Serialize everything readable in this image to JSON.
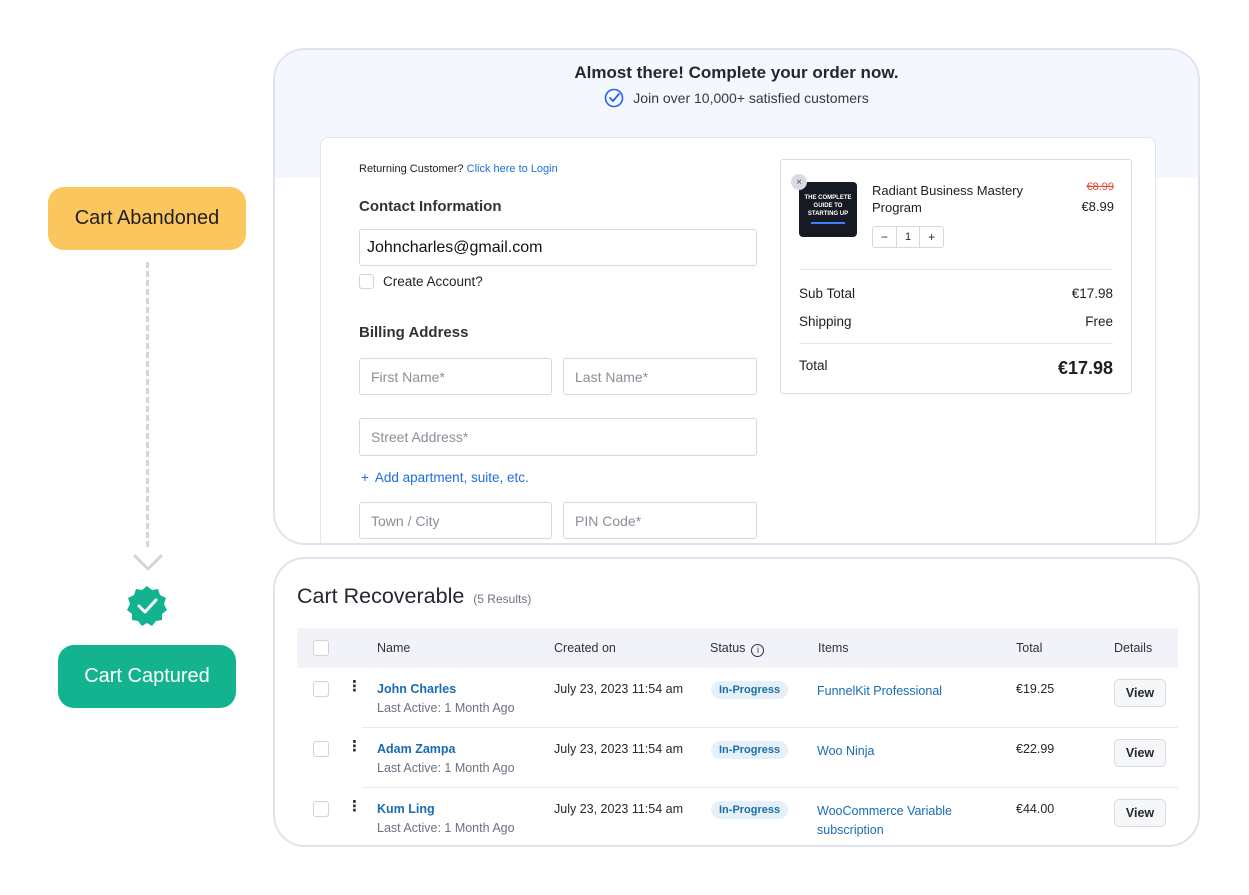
{
  "flow": {
    "abandoned_label": "Cart Abandoned",
    "captured_label": "Cart Captured",
    "abandoned_color": "#fcc65e",
    "captured_color": "#14b38f"
  },
  "checkout": {
    "title": "Almost there! Complete your order now.",
    "subtitle": "Join over 10,000+ satisfied customers",
    "returning_text": "Returning Customer?",
    "login_link": "Click here to Login",
    "contact_heading": "Contact Information",
    "email_value": "Johncharles@gmail.com",
    "create_account": "Create Account?",
    "billing_heading": "Billing Address",
    "first_name_placeholder": "First Name*",
    "last_name_placeholder": "Last Name*",
    "street_placeholder": "Street Address*",
    "add_apartment": "Add apartment, suite, etc.",
    "town_placeholder": "Town / City",
    "pin_placeholder": "PIN Code*"
  },
  "order_summary": {
    "product_image_text": "THE COMPLETE GUIDE TO STARTING UP",
    "product_name": "Radiant Business Mastery Program",
    "price_old": "€8.99",
    "price_new": "€8.99",
    "quantity": "1",
    "subtotal_label": "Sub Total",
    "subtotal_value": "€17.98",
    "shipping_label": "Shipping",
    "shipping_value": "Free",
    "total_label": "Total",
    "total_value": "€17.98"
  },
  "recoverable": {
    "title": "Cart Recoverable",
    "count": "(5 Results)",
    "columns": {
      "name": "Name",
      "created": "Created on",
      "status": "Status",
      "items": "Items",
      "total": "Total",
      "details": "Details"
    },
    "rows": [
      {
        "name": "John Charles",
        "active": "Last Active: 1 Month Ago",
        "created": "July 23, 2023 11:54 am",
        "status": "In-Progress",
        "items": "FunnelKit Professional",
        "total": "€19.25",
        "action": "View"
      },
      {
        "name": "Adam Zampa",
        "active": "Last Active: 1 Month Ago",
        "created": "July 23, 2023 11:54 am",
        "status": "In-Progress",
        "items": "Woo Ninja",
        "total": "€22.99",
        "action": "View"
      },
      {
        "name": "Kum Ling",
        "active": "Last Active: 1 Month Ago",
        "created": "July 23, 2023 11:54 am",
        "status": "In-Progress",
        "items": "WooCommerce Variable subscription",
        "total": "€44.00",
        "action": "View"
      }
    ]
  }
}
